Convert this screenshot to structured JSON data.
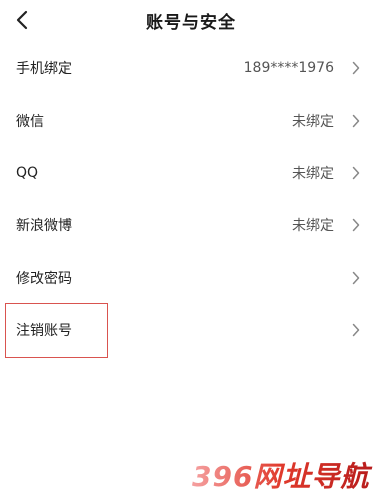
{
  "header": {
    "title": "账号与安全"
  },
  "list": {
    "items": [
      {
        "label": "手机绑定",
        "value": "189****1976"
      },
      {
        "label": "微信",
        "value": "未绑定"
      },
      {
        "label": "QQ",
        "value": "未绑定"
      },
      {
        "label": "新浪微博",
        "value": "未绑定"
      },
      {
        "label": "修改密码",
        "value": ""
      },
      {
        "label": "注销账号",
        "value": ""
      }
    ]
  },
  "watermark": {
    "text": "396网址导航"
  },
  "colors": {
    "highlight_border": "#d9534f",
    "watermark_red": "#e0392b"
  }
}
